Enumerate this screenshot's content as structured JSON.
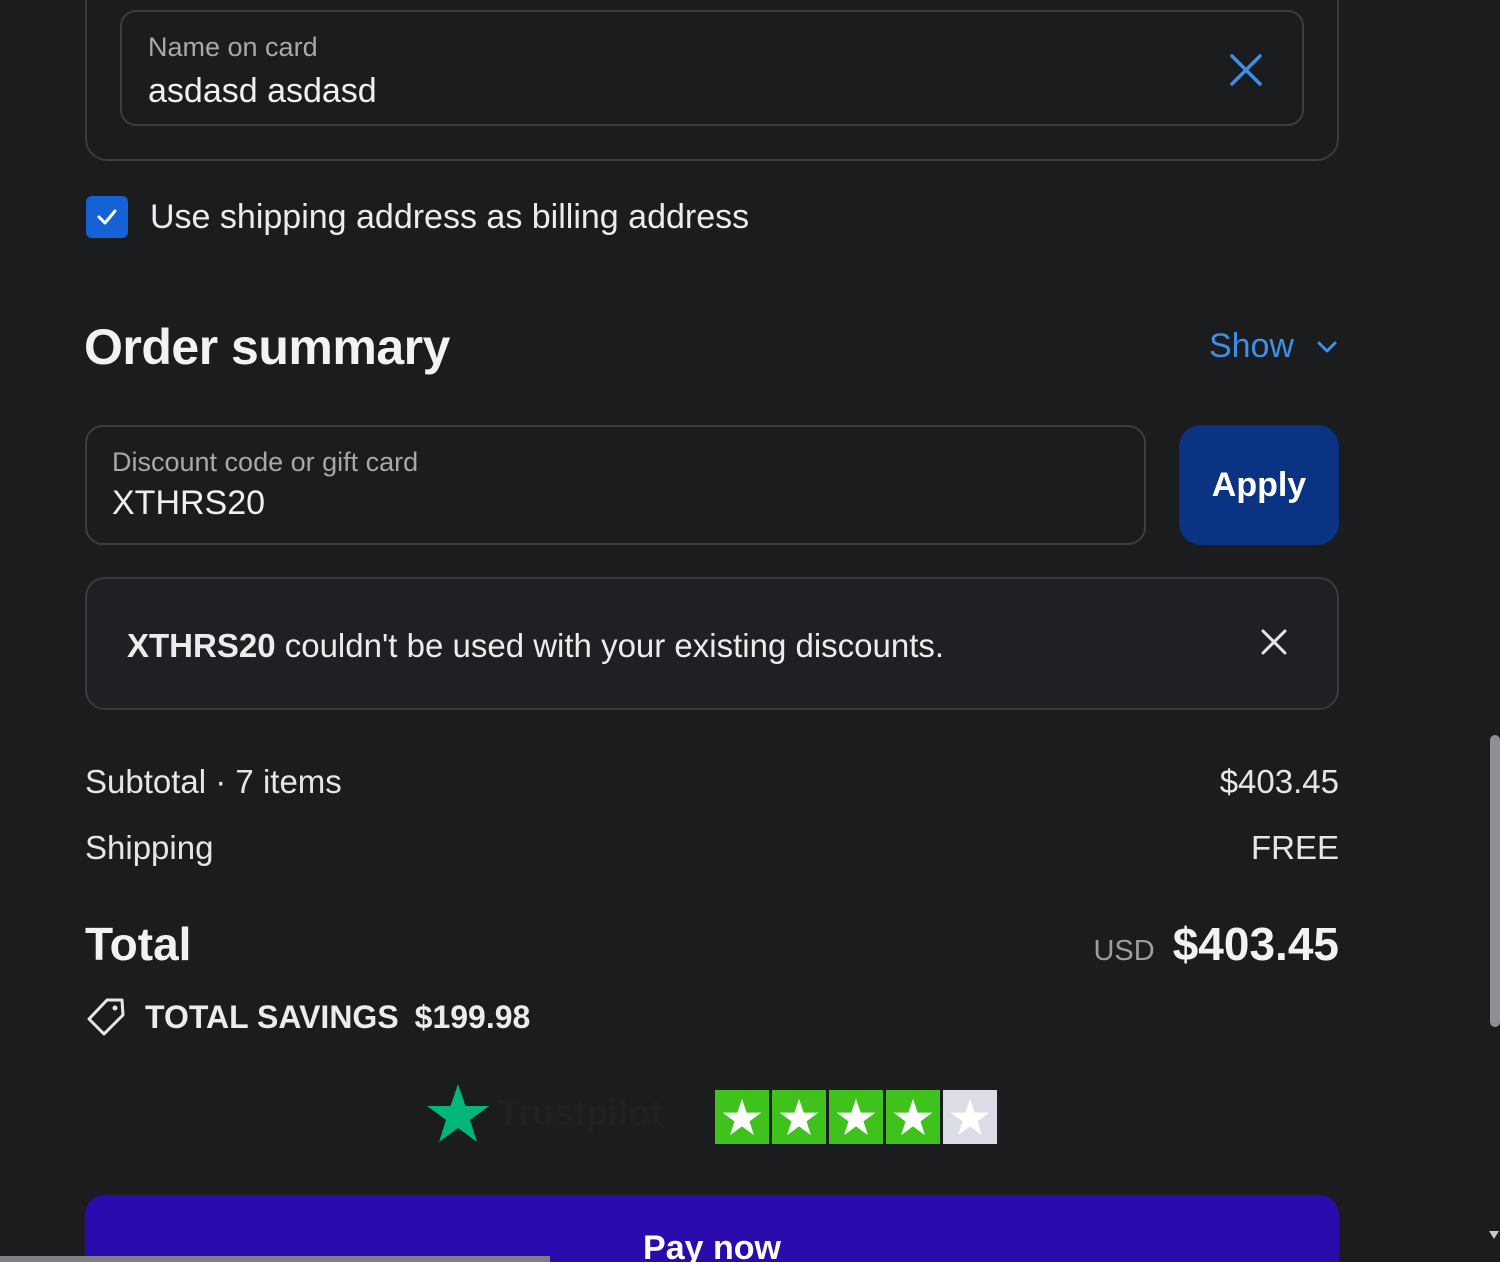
{
  "card": {
    "name_label": "Name on card",
    "name_value": "asdasd asdasd"
  },
  "billing": {
    "checkbox_label": "Use shipping address as billing address",
    "checked": true
  },
  "summary": {
    "title": "Order summary",
    "toggle_label": "Show"
  },
  "discount": {
    "label": "Discount code or gift card",
    "value": "XTHRS20",
    "apply_label": "Apply"
  },
  "alert": {
    "code": "XTHRS20",
    "message": " couldn't be used with your existing discounts."
  },
  "totals": {
    "subtotal_label": "Subtotal · 7 items",
    "subtotal_value": "$403.45",
    "shipping_label": "Shipping",
    "shipping_value": "FREE",
    "total_label": "Total",
    "currency": "USD",
    "total_value": "$403.45",
    "savings_label": "TOTAL SAVINGS",
    "savings_value": "$199.98"
  },
  "trustpilot": {
    "word": "Trustpilot",
    "rating_stars": 4,
    "max_stars": 5
  },
  "pay": {
    "label": "Pay now"
  },
  "colors": {
    "background": "#1b1c1e",
    "accent_link": "#3e8fe6",
    "apply_button": "#0a3383",
    "pay_button": "#2a0cae",
    "checkbox": "#1562d6",
    "trustpilot_green": "#3fc31c",
    "trustpilot_logo": "#00b67a"
  },
  "icons": [
    "close-icon",
    "check-icon",
    "chevron-down-icon",
    "tag-icon",
    "trustpilot-star-icon"
  ]
}
